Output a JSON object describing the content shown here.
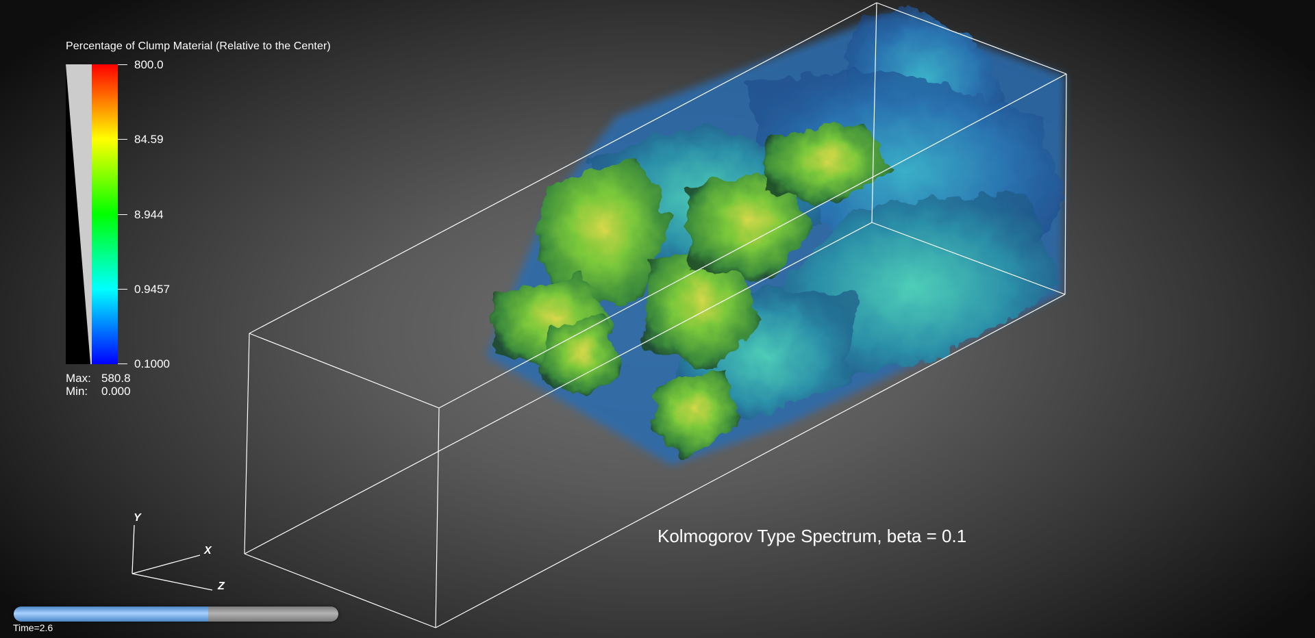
{
  "legend": {
    "title": "Percentage of Clump Material (Relative to the Center)",
    "ticks": [
      {
        "label": "800.0",
        "fraction": 0.0
      },
      {
        "label": "84.59",
        "fraction": 0.25
      },
      {
        "label": "8.944",
        "fraction": 0.5
      },
      {
        "label": "0.9457",
        "fraction": 0.75
      },
      {
        "label": "0.1000",
        "fraction": 1.0
      }
    ],
    "max_label": "Max:",
    "max_value": "580.8",
    "min_label": "Min:",
    "min_value": "0.000"
  },
  "colormap": [
    "#0000ff",
    "#0080ff",
    "#00ffff",
    "#00ff80",
    "#00ff00",
    "#80ff00",
    "#ffff00",
    "#ff8000",
    "#ff0000"
  ],
  "annotation": "Kolmogorov Type Spectrum, beta = 0.1",
  "axes": {
    "x": "X",
    "y": "Y",
    "z": "Z"
  },
  "time": {
    "label": "Time=2.6",
    "progress": 0.6
  },
  "colors": {
    "outline": "#ffffff",
    "slider_fill": "#8fbef5",
    "slider_track": "#a6a6a6"
  }
}
